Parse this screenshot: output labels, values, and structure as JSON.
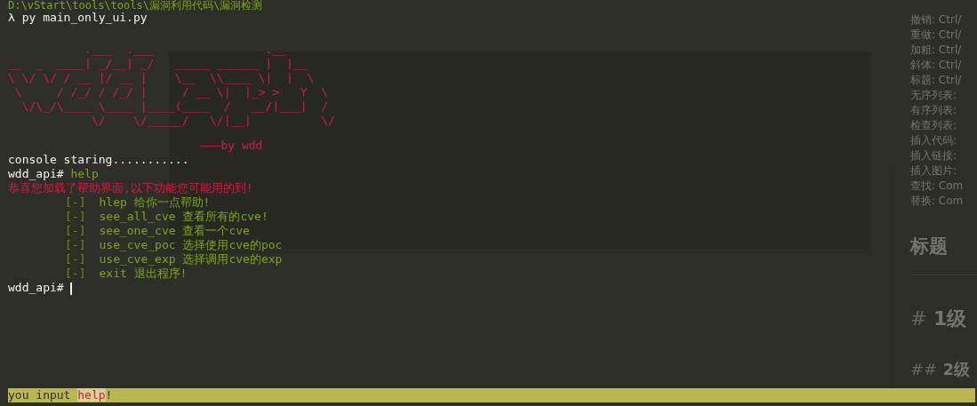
{
  "terminal": {
    "path_line": "D:\\vStart\\tools\\tools\\漏洞利用代码\\漏洞检测",
    "command_line": "λ py main_only_ui.py",
    "banner": {
      "lines": [
        "           .___  .___                .__",
        "__  _  ____| _/__| _/   _____ ______ |  |__",
        "\\ \\/ \\/ / __ |/ __ |    \\__  \\\\____ \\|  |  \\",
        " \\     / /_/ / /_/ |     / __ \\|  |_> >   Y  \\",
        "  \\/\\_/\\____ \\____ |____(____  /   __/|___|  /",
        "            \\/    \\/_____/   \\/|__|          \\/"
      ],
      "signature": "———by wdd"
    },
    "startup": "console staring...........",
    "prompt": "wdd_api#",
    "entered": "help",
    "welcome": "恭喜您加载了帮助界面,以下功能您可能用的到!",
    "help_items": [
      {
        "bullet": "[-]",
        "text": "hlep 给你一点帮助!"
      },
      {
        "bullet": "[-]",
        "text": "see_all_cve 查看所有的cve!"
      },
      {
        "bullet": "[-]",
        "text": "see_one_cve 查看一个cve"
      },
      {
        "bullet": "[-]",
        "text": "use_cve_poc 选择使用cve的poc"
      },
      {
        "bullet": "[-]",
        "text": "use_cve_exp 选择调用cve的exp"
      },
      {
        "bullet": "[-]",
        "text": "exit 退出程序!"
      }
    ],
    "last_prompt": "wdd_api#"
  },
  "background_editor": {
    "shortcuts": [
      "撤销: Ctrl/",
      "重做: Ctrl/",
      "加粗: Ctrl/",
      "斜体: Ctrl/",
      "标题: Ctrl/",
      "无序列表:",
      "有序列表:",
      "检查列表:",
      "插入代码:",
      "插入链接:",
      "插入图片:",
      "查找: Com",
      "替换: Com"
    ],
    "heading": "标题",
    "h1": {
      "mark": "#",
      "text": "1级"
    },
    "h2": {
      "mark": "##",
      "text": "2级"
    }
  },
  "status_bar": {
    "prefix": "you input ",
    "command": "help",
    "suffix": "!"
  }
}
